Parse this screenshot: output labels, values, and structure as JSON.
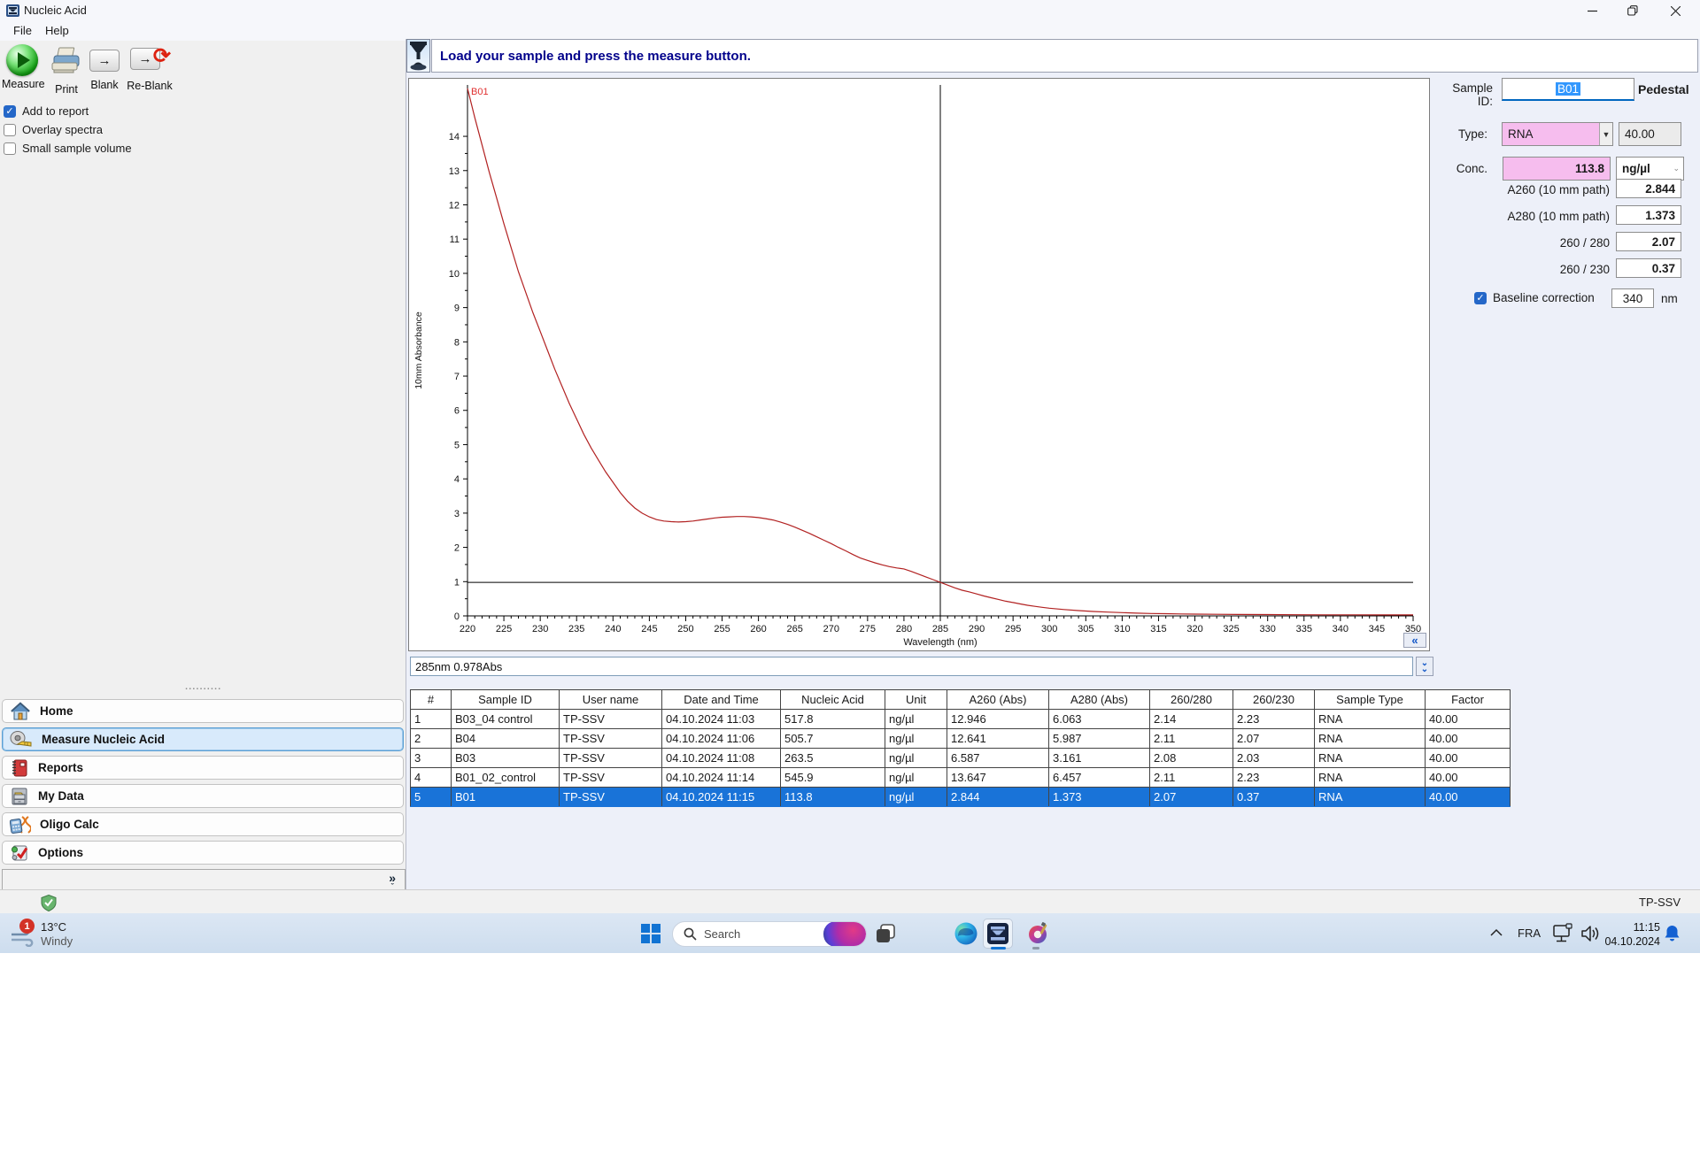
{
  "window": {
    "title": "Nucleic Acid"
  },
  "menu": {
    "items": [
      {
        "label": "File"
      },
      {
        "label": "Help"
      }
    ]
  },
  "toolbar": {
    "measure_label": "Measure",
    "print_label": "Print",
    "blank_label": "Blank",
    "reblank_label": "Re-Blank"
  },
  "options_checkboxes": [
    {
      "label": "Add to report",
      "checked": true
    },
    {
      "label": "Overlay spectra",
      "checked": false
    },
    {
      "label": "Small sample volume",
      "checked": false
    }
  ],
  "message_bar": {
    "text": "Load your sample and press the measure button."
  },
  "sample_panel": {
    "sample_id_label": "Sample ID:",
    "sample_id_value": "B01",
    "mode_label": "Pedestal",
    "type_label": "Type:",
    "type_value": "RNA",
    "type_factor": "40.00",
    "conc_label": "Conc.",
    "conc_value": "113.8",
    "conc_unit": "ng/µl",
    "metrics": [
      {
        "label": "A260 (10 mm path)",
        "value": "2.844"
      },
      {
        "label": "A280 (10 mm path)",
        "value": "1.373"
      },
      {
        "label": "260 / 280",
        "value": "2.07"
      },
      {
        "label": "260 / 230",
        "value": "0.37"
      }
    ],
    "baseline": {
      "label": "Baseline correction",
      "checked": true,
      "value": "340",
      "unit": "nm"
    }
  },
  "chart_status": {
    "text": "285nm 0.978Abs"
  },
  "chart_data": {
    "type": "line",
    "title": "",
    "xlabel": "Wavelength (nm)",
    "ylabel": "10mm Absorbance",
    "xlim": [
      220,
      350
    ],
    "ylim": [
      0,
      15.5
    ],
    "xtick_step": 5,
    "ytick_step": 1,
    "ytick_max": 14,
    "curve_label": "B01",
    "curve_color": "#b22222",
    "crosshair": {
      "wavelength": 285,
      "absorbance": 0.978
    },
    "series": [
      {
        "name": "B01",
        "points": [
          [
            220,
            15.4
          ],
          [
            221,
            14.55
          ],
          [
            222,
            13.75
          ],
          [
            223,
            12.95
          ],
          [
            224,
            12.2
          ],
          [
            225,
            11.45
          ],
          [
            226,
            10.75
          ],
          [
            227,
            10.05
          ],
          [
            228,
            9.45
          ],
          [
            229,
            8.85
          ],
          [
            230,
            8.3
          ],
          [
            231,
            7.75
          ],
          [
            232,
            7.2
          ],
          [
            233,
            6.7
          ],
          [
            234,
            6.2
          ],
          [
            235,
            5.75
          ],
          [
            236,
            5.3
          ],
          [
            237,
            4.9
          ],
          [
            238,
            4.55
          ],
          [
            239,
            4.2
          ],
          [
            240,
            3.9
          ],
          [
            241,
            3.6
          ],
          [
            242,
            3.35
          ],
          [
            243,
            3.15
          ],
          [
            244,
            3.0
          ],
          [
            245,
            2.89
          ],
          [
            246,
            2.81
          ],
          [
            247,
            2.77
          ],
          [
            248,
            2.75
          ],
          [
            249,
            2.74
          ],
          [
            250,
            2.75
          ],
          [
            251,
            2.77
          ],
          [
            252,
            2.8
          ],
          [
            253,
            2.83
          ],
          [
            254,
            2.86
          ],
          [
            255,
            2.88
          ],
          [
            256,
            2.89
          ],
          [
            257,
            2.9
          ],
          [
            258,
            2.9
          ],
          [
            259,
            2.89
          ],
          [
            260,
            2.87
          ],
          [
            261,
            2.84
          ],
          [
            262,
            2.8
          ],
          [
            263,
            2.74
          ],
          [
            264,
            2.67
          ],
          [
            265,
            2.59
          ],
          [
            266,
            2.5
          ],
          [
            267,
            2.41
          ],
          [
            268,
            2.31
          ],
          [
            269,
            2.21
          ],
          [
            270,
            2.11
          ],
          [
            271,
            2.0
          ],
          [
            272,
            1.9
          ],
          [
            273,
            1.79
          ],
          [
            274,
            1.69
          ],
          [
            275,
            1.62
          ],
          [
            276,
            1.55
          ],
          [
            277,
            1.49
          ],
          [
            278,
            1.44
          ],
          [
            279,
            1.4
          ],
          [
            280,
            1.373
          ],
          [
            281,
            1.3
          ],
          [
            282,
            1.22
          ],
          [
            283,
            1.14
          ],
          [
            284,
            1.06
          ],
          [
            285,
            0.978
          ],
          [
            286,
            0.9
          ],
          [
            287,
            0.82
          ],
          [
            288,
            0.75
          ],
          [
            289,
            0.7
          ],
          [
            290,
            0.64
          ],
          [
            291,
            0.58
          ],
          [
            292,
            0.53
          ],
          [
            293,
            0.48
          ],
          [
            294,
            0.43
          ],
          [
            295,
            0.39
          ],
          [
            296,
            0.35
          ],
          [
            297,
            0.31
          ],
          [
            298,
            0.28
          ],
          [
            299,
            0.25
          ],
          [
            300,
            0.225
          ],
          [
            302,
            0.185
          ],
          [
            304,
            0.155
          ],
          [
            306,
            0.13
          ],
          [
            308,
            0.11
          ],
          [
            310,
            0.095
          ],
          [
            312,
            0.08
          ],
          [
            314,
            0.07
          ],
          [
            316,
            0.065
          ],
          [
            318,
            0.058
          ],
          [
            320,
            0.052
          ],
          [
            323,
            0.047
          ],
          [
            326,
            0.042
          ],
          [
            330,
            0.038
          ],
          [
            334,
            0.034
          ],
          [
            338,
            0.032
          ],
          [
            342,
            0.03
          ],
          [
            346,
            0.029
          ],
          [
            350,
            0.028
          ]
        ]
      }
    ]
  },
  "table": {
    "columns": [
      "#",
      "Sample ID",
      "User name",
      "Date and Time",
      "Nucleic Acid",
      "Unit",
      "A260 (Abs)",
      "A280 (Abs)",
      "260/280",
      "260/230",
      "Sample Type",
      "Factor"
    ],
    "rows": [
      [
        "1",
        "B03_04 control",
        "TP-SSV",
        "04.10.2024 11:03",
        "517.8",
        "ng/µl",
        "12.946",
        "6.063",
        "2.14",
        "2.23",
        "RNA",
        "40.00"
      ],
      [
        "2",
        "B04",
        "TP-SSV",
        "04.10.2024 11:06",
        "505.7",
        "ng/µl",
        "12.641",
        "5.987",
        "2.11",
        "2.07",
        "RNA",
        "40.00"
      ],
      [
        "3",
        "B03",
        "TP-SSV",
        "04.10.2024 11:08",
        "263.5",
        "ng/µl",
        "6.587",
        "3.161",
        "2.08",
        "2.03",
        "RNA",
        "40.00"
      ],
      [
        "4",
        "B01_02_control",
        "TP-SSV",
        "04.10.2024 11:14",
        "545.9",
        "ng/µl",
        "13.647",
        "6.457",
        "2.11",
        "2.23",
        "RNA",
        "40.00"
      ],
      [
        "5",
        "B01",
        "TP-SSV",
        "04.10.2024 11:15",
        "113.8",
        "ng/µl",
        "2.844",
        "1.373",
        "2.07",
        "0.37",
        "RNA",
        "40.00"
      ]
    ],
    "selected_row_index": 4
  },
  "sidebar": {
    "items": [
      {
        "label": "Home"
      },
      {
        "label": "Measure Nucleic Acid"
      },
      {
        "label": "Reports"
      },
      {
        "label": "My Data"
      },
      {
        "label": "Oligo Calc"
      },
      {
        "label": "Options"
      }
    ],
    "selected_index": 1
  },
  "app_status_bar": {
    "user": "TP-SSV"
  },
  "taskbar": {
    "weather": {
      "badge": "1",
      "temperature": "13°C",
      "condition": "Windy"
    },
    "search": {
      "placeholder": "Search"
    },
    "tray": {
      "language": "FRA",
      "time": "11:15",
      "date": "04.10.2024"
    }
  }
}
